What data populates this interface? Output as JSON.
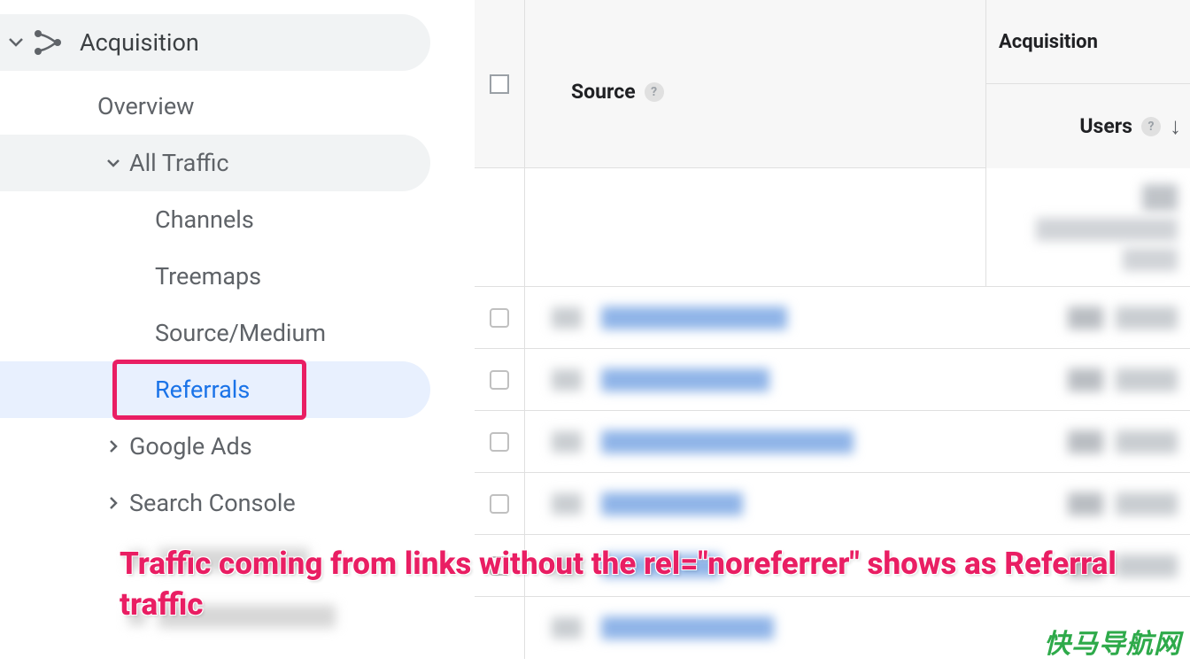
{
  "sidebar": {
    "section_label": "Acquisition",
    "overview": "Overview",
    "all_traffic": "All Traffic",
    "channels": "Channels",
    "treemaps": "Treemaps",
    "source_medium": "Source/Medium",
    "referrals": "Referrals",
    "google_ads": "Google Ads",
    "search_console": "Search Console"
  },
  "table": {
    "col_source": "Source",
    "group_acquisition": "Acquisition",
    "col_users": "Users"
  },
  "annotation": {
    "text": "Traffic coming from links without the rel=\"noreferrer\" shows as Referral traffic"
  },
  "watermark": "快马导航网"
}
